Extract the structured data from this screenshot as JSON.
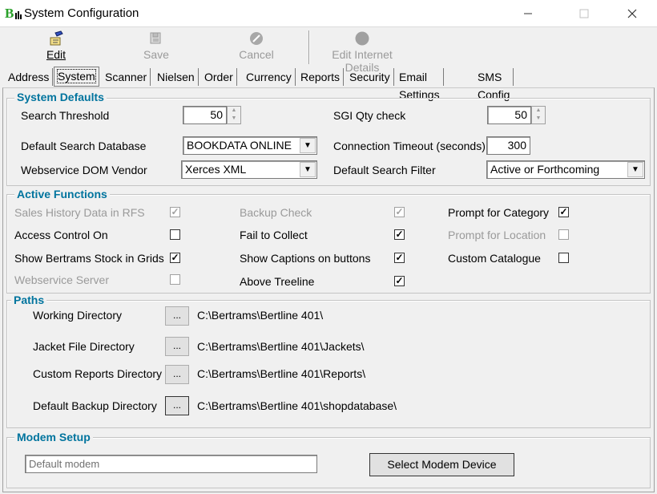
{
  "window": {
    "title": "System Configuration"
  },
  "toolbar": {
    "edit_label": "Edit",
    "save_label": "Save",
    "cancel_label": "Cancel",
    "internet_label": "Edit Internet Details"
  },
  "tabs": [
    "Address",
    "System",
    "Scanner",
    "Nielsen",
    "Order",
    "Currency",
    "Reports",
    "Security",
    "Email Settings",
    "SMS Config"
  ],
  "system_defaults": {
    "title": "System Defaults",
    "search_threshold_label": "Search Threshold",
    "search_threshold_value": "50",
    "sgi_qty_label": "SGI Qty check",
    "sgi_qty_value": "50",
    "default_db_label": "Default Search Database",
    "default_db_value": "BOOKDATA ONLINE",
    "timeout_label": "Connection Timeout (seconds)",
    "timeout_value": "300",
    "dom_vendor_label": "Webservice DOM Vendor",
    "dom_vendor_value": "Xerces XML",
    "search_filter_label": "Default Search Filter",
    "search_filter_value": "Active or Forthcoming"
  },
  "active_functions": {
    "title": "Active Functions",
    "items": [
      {
        "label": "Sales History Data in RFS",
        "checked": "✓",
        "enabled": false
      },
      {
        "label": "Backup Check",
        "checked": "✓",
        "enabled": false
      },
      {
        "label": "Prompt for Category",
        "checked": "✓",
        "enabled": true
      },
      {
        "label": "Access Control On",
        "checked": "",
        "enabled": true
      },
      {
        "label": "Fail to Collect",
        "checked": "✓",
        "enabled": true
      },
      {
        "label": "Prompt for Location",
        "checked": "",
        "enabled": false
      },
      {
        "label": "Show Bertrams Stock in Grids",
        "checked": "✓",
        "enabled": true
      },
      {
        "label": "Show Captions on buttons",
        "checked": "✓",
        "enabled": true
      },
      {
        "label": "Custom Catalogue",
        "checked": "",
        "enabled": true
      },
      {
        "label": "Webservice Server",
        "checked": "",
        "enabled": false
      },
      {
        "label": "Above Treeline",
        "checked": "✓",
        "enabled": true
      }
    ]
  },
  "paths": {
    "title": "Paths",
    "browse_label": "...",
    "working_label": "Working Directory",
    "working_value": "C:\\Bertrams\\Bertline 401\\",
    "jacket_label": "Jacket File Directory",
    "jacket_value": "C:\\Bertrams\\Bertline 401\\Jackets\\",
    "reports_label": "Custom Reports Directory",
    "reports_value": "C:\\Bertrams\\Bertline 401\\Reports\\",
    "backup_label": "Default Backup Directory",
    "backup_value": "C:\\Bertrams\\Bertline 401\\shopdatabase\\"
  },
  "modem": {
    "title": "Modem Setup",
    "field_value": "Default modem",
    "select_label": "Select Modem Device"
  },
  "colors": {
    "group_title": "#00749e",
    "disabled_text": "#9a9a9a"
  }
}
